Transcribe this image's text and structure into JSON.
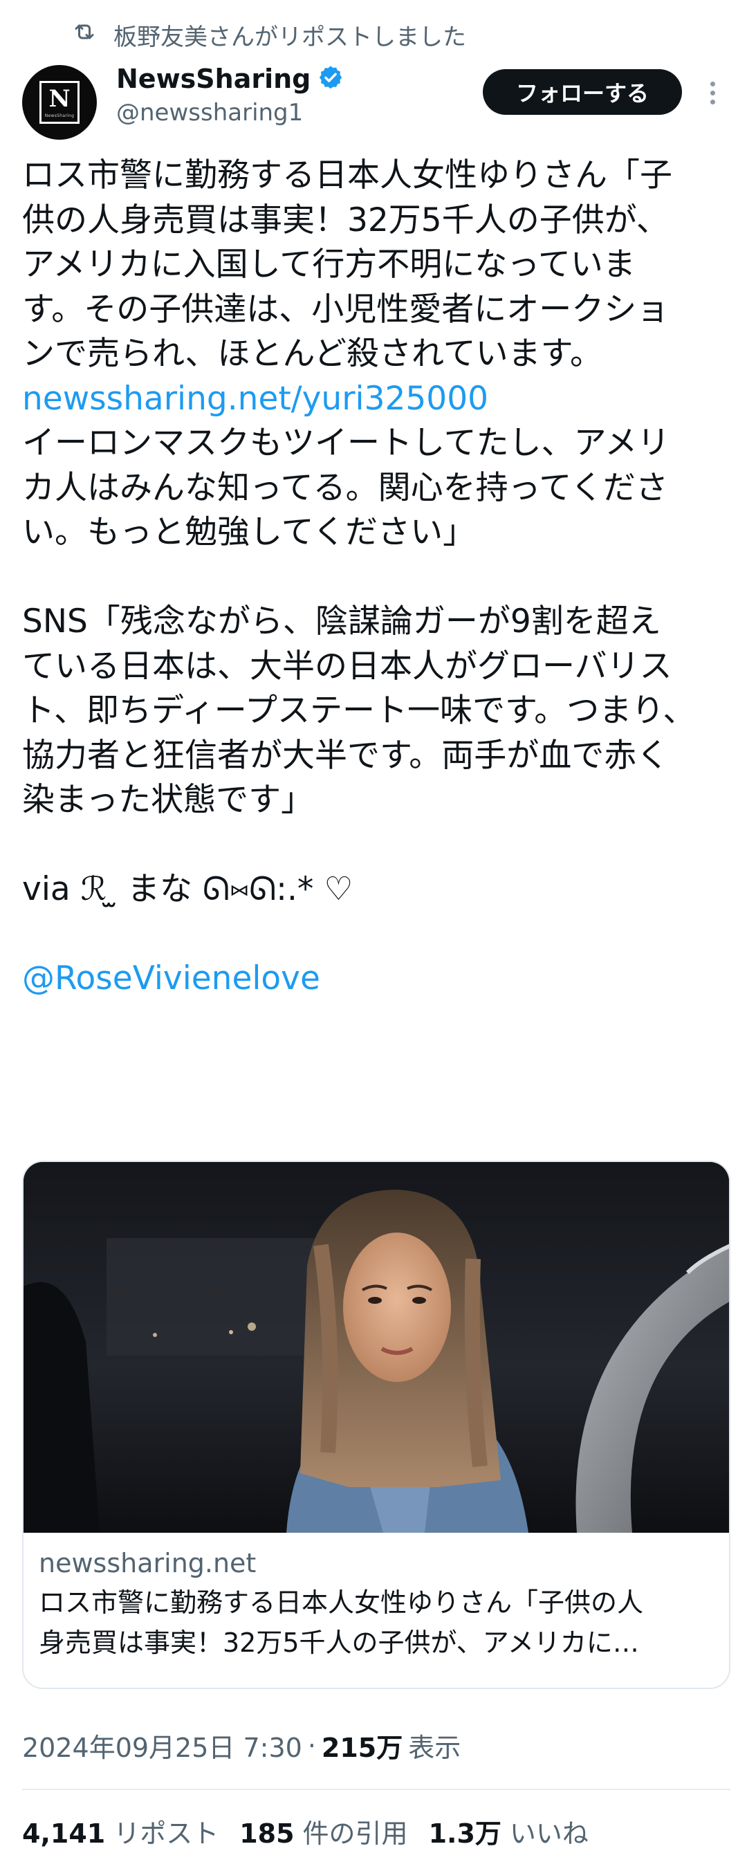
{
  "repost_context": {
    "text": "板野友美さんがリポストしました",
    "icon": "repost-icon"
  },
  "author": {
    "display_name": "NewsSharing",
    "handle": "@newssharing1",
    "avatar_letter": "N",
    "avatar_caption": "NewsSharing",
    "verified": true
  },
  "follow_button": "フォローする",
  "tweet": {
    "lines": [
      "ロス市警に勤務する日本人女性ゆりさん「子",
      "供の人身売買は事実！32万5千人の子供が、",
      "アメリカに入国して行方不明になっていま",
      "す。その子供達は、小児性愛者にオークショ",
      "ンで売られ、ほとんど殺されています。"
    ],
    "link": "newssharing.net/yuri325000",
    "lines2": [
      "イーロンマスクもツイートしてたし、アメリ",
      "カ人はみんな知ってる。関心を持ってくださ",
      "い。もっと勉強してください」"
    ],
    "lines3": [
      "SNS「残念ながら、陰謀論ガーが9割を超え",
      "ている日本は、大半の日本人がグローバリス",
      "ト、即ちディープステート一味です。つまり、",
      "協力者と狂信者が大半です。両手が血で赤く",
      "染まった状態です」"
    ],
    "via": "via ℛ ̫ まな ᘏ⑅ᘏ:.* ♡",
    "mention": "@RoseVivienelove"
  },
  "card": {
    "domain": "newssharing.net",
    "title_line1": "ロス市警に勤務する日本人女性ゆりさん「子供の人",
    "title_line2": "身売買は事実！32万5千人の子供が、アメリカに…"
  },
  "meta": {
    "timestamp": "2024年09月25日 7:30",
    "separator": "·",
    "views_count": "215万",
    "views_label": "表示"
  },
  "stats": {
    "reposts_count": "4,141",
    "reposts_label": "リポスト",
    "quotes_count": "185",
    "quotes_label": "件の引用",
    "likes_count": "1.3万",
    "likes_label": "いいね"
  },
  "colors": {
    "link": "#1d9bf0",
    "secondary": "#536471",
    "verified": "#1d9bf0"
  }
}
